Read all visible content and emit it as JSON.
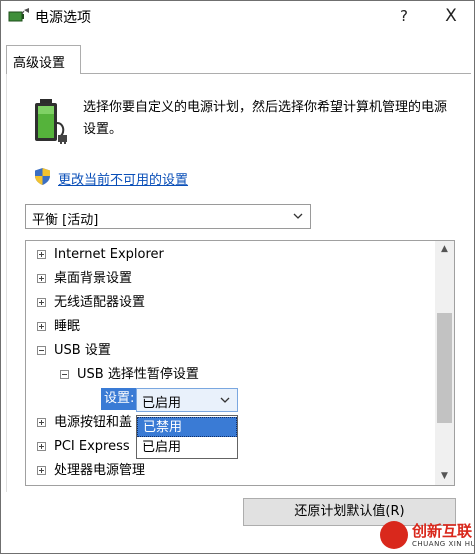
{
  "window": {
    "title": "电源选项",
    "help_label": "?",
    "close_label": "X"
  },
  "tabs": [
    {
      "label": "高级设置"
    }
  ],
  "description": "选择你要自定义的电源计划，然后选择你希望计算机管理的电源设置。",
  "change_settings_link": "更改当前不可用的设置",
  "plan_select": {
    "value": "平衡 [活动]"
  },
  "tree": {
    "items": [
      {
        "label": "Internet Explorer",
        "expanded": false
      },
      {
        "label": "桌面背景设置",
        "expanded": false
      },
      {
        "label": "无线适配器设置",
        "expanded": false
      },
      {
        "label": "睡眠",
        "expanded": false
      },
      {
        "label": "USB 设置",
        "expanded": true
      },
      {
        "label": "USB 选择性暂停设置",
        "expanded": true
      },
      {
        "label": "电源按钮和盖",
        "expanded": false
      },
      {
        "label": "PCI Express",
        "expanded": false
      },
      {
        "label": "处理器电源管理",
        "expanded": false
      }
    ],
    "setting": {
      "label": "设置:",
      "value": "已启用",
      "options": [
        "已禁用",
        "已启用"
      ],
      "highlighted_option": "已禁用"
    }
  },
  "buttons": {
    "reset_label": "还原计划默认值(R)"
  },
  "watermark": {
    "text": "创新互联",
    "subtext": "CHUANG XIN HU LIAN"
  },
  "colors": {
    "selection": "#3a7bd5",
    "link": "#0a4fb8",
    "watermark": "#d9281c"
  }
}
